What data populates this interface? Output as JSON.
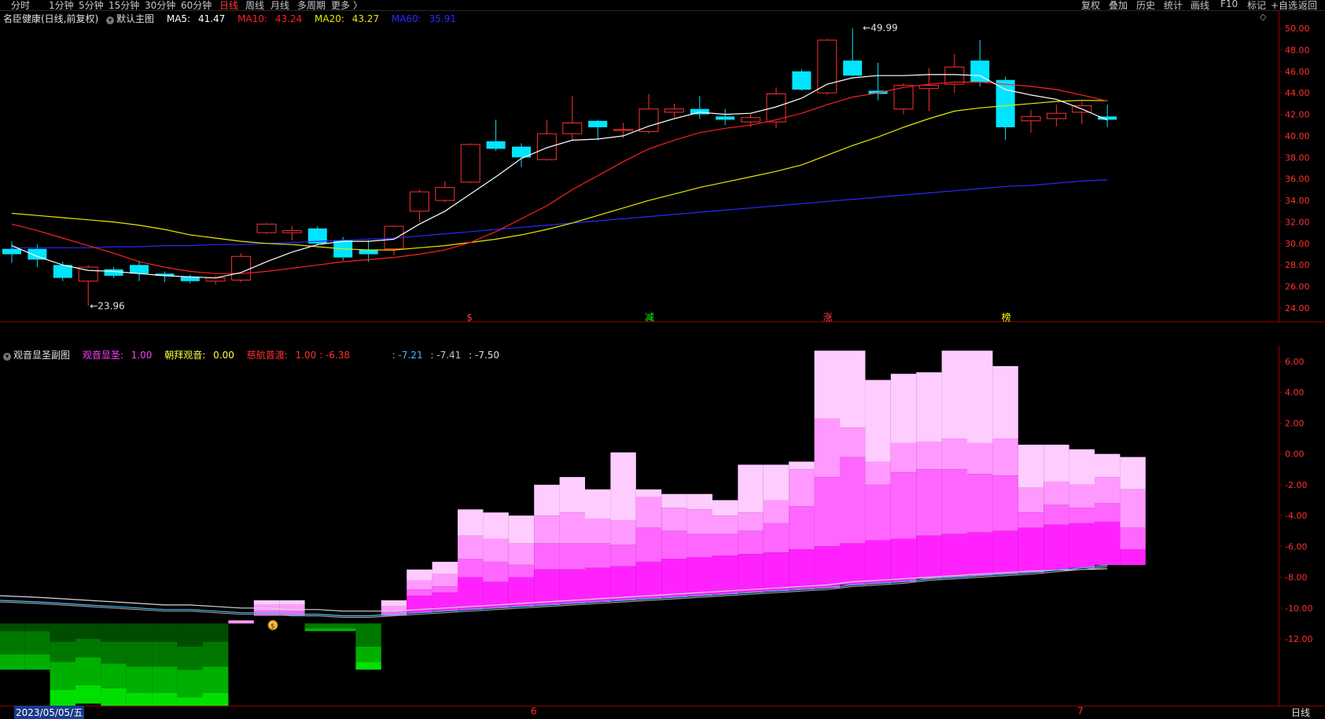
{
  "toolbar": {
    "left_items": [
      "分时",
      "1分钟",
      "5分钟",
      "15分钟",
      "30分钟",
      "60分钟",
      "日线",
      "周线",
      "月线",
      "多周期",
      "更多 〉"
    ],
    "active_item": "日线",
    "right_items": [
      "复权",
      "叠加",
      "历史",
      "统计",
      "画线",
      "F10",
      "标记",
      "+自选",
      "返回"
    ]
  },
  "main_chart": {
    "title": "名臣健康(日线,前复权)",
    "indicator_name": "默认主图",
    "ma5": {
      "label": "MA5:",
      "value": "41.47",
      "color": "#ffffff"
    },
    "ma10": {
      "label": "MA10:",
      "value": "43.24",
      "color": "#ff2020"
    },
    "ma20": {
      "label": "MA20:",
      "value": "43.27",
      "color": "#e8e800"
    },
    "ma60": {
      "label": "MA60:",
      "value": "35.91",
      "color": "#2a2aff"
    },
    "high_label": "49.99",
    "low_label": "23.96",
    "y_ticks": [
      "50.00",
      "48.00",
      "46.00",
      "44.00",
      "42.00",
      "40.00",
      "38.00",
      "36.00",
      "34.00",
      "32.00",
      "30.00",
      "28.00",
      "26.00",
      "24.00"
    ],
    "event_marks": [
      {
        "text": "$",
        "color": "#ff3b3b"
      },
      {
        "text": "减",
        "color": "#00ff00"
      },
      {
        "text": "涨",
        "color": "#ff3b3b"
      },
      {
        "text": "榜",
        "color": "#ffff00"
      }
    ],
    "colors": {
      "up": "#ff3030",
      "down": "#00e5ff",
      "ma5": "#ffffff",
      "ma10": "#ff2020",
      "ma20": "#e8e800",
      "ma60": "#2a2aff"
    }
  },
  "sub_chart": {
    "title": "观音显圣副图",
    "item1": {
      "label": "观音显圣:",
      "value": "1.00",
      "color": "#ff40ff"
    },
    "item2": {
      "label": "朝拜观音:",
      "value": "0.00",
      "color": "#ffff40"
    },
    "item3": {
      "label": "慈航普渡:",
      "value": "1.00 : -6.38",
      "color": "#ff3030"
    },
    "item4": {
      "value": ": -7.21",
      "color": "#40c0ff"
    },
    "item5": {
      "value": ": -7.41",
      "color": "#c0c0c0"
    },
    "item6": {
      "value": ": -7.50",
      "color": "#e0e0e0"
    },
    "y_ticks": [
      "6.00",
      "4.00",
      "2.00",
      "0.00",
      "-2.00",
      "-4.00",
      "-6.00",
      "-8.00",
      "-10.00",
      "-12.00"
    ],
    "money_icon": "money-bag-icon"
  },
  "bottom": {
    "date_label": "2023/05/05/五",
    "month_marks": [
      "6",
      "7"
    ],
    "period_label": "日线"
  },
  "chart_data": {
    "type": "candlestick",
    "ohlc": [
      [
        29.5,
        30.2,
        28.2,
        29.0
      ],
      [
        29.5,
        29.9,
        27.8,
        28.5
      ],
      [
        28.0,
        28.3,
        26.5,
        26.8
      ],
      [
        26.5,
        28.0,
        24.2,
        27.8
      ],
      [
        27.6,
        27.8,
        26.8,
        27.0
      ],
      [
        28.0,
        28.4,
        26.5,
        27.2
      ],
      [
        27.2,
        27.4,
        26.4,
        27.0
      ],
      [
        26.9,
        27.1,
        26.3,
        26.5
      ],
      [
        26.5,
        27.0,
        26.2,
        26.8
      ],
      [
        26.6,
        29.1,
        26.4,
        28.8
      ],
      [
        31.0,
        31.9,
        30.9,
        31.8
      ],
      [
        31.0,
        31.6,
        30.3,
        31.2
      ],
      [
        31.4,
        31.6,
        29.8,
        30.0
      ],
      [
        30.3,
        30.6,
        28.4,
        28.7
      ],
      [
        29.4,
        30.3,
        28.3,
        29.0
      ],
      [
        29.5,
        31.7,
        28.9,
        31.6
      ],
      [
        33.0,
        35.0,
        32.0,
        34.8
      ],
      [
        34.0,
        35.8,
        33.8,
        35.2
      ],
      [
        35.7,
        39.3,
        35.6,
        39.2
      ],
      [
        39.5,
        41.5,
        38.6,
        38.8
      ],
      [
        39.0,
        39.3,
        37.1,
        38.0
      ],
      [
        37.8,
        41.5,
        37.7,
        40.2
      ],
      [
        40.2,
        43.7,
        39.6,
        41.2
      ],
      [
        41.4,
        41.5,
        39.6,
        40.8
      ],
      [
        40.5,
        41.2,
        39.8,
        40.6
      ],
      [
        40.4,
        43.9,
        40.2,
        42.5
      ],
      [
        42.2,
        43.0,
        41.7,
        42.5
      ],
      [
        42.5,
        43.7,
        41.6,
        42.0
      ],
      [
        41.8,
        42.5,
        41.0,
        41.5
      ],
      [
        41.3,
        42.0,
        40.8,
        41.7
      ],
      [
        41.3,
        44.5,
        40.7,
        43.9
      ],
      [
        46.0,
        46.2,
        44.2,
        44.3
      ],
      [
        44.0,
        49.0,
        43.8,
        48.9
      ],
      [
        47.0,
        50.0,
        45.8,
        45.6
      ],
      [
        44.2,
        46.8,
        43.3,
        43.9
      ],
      [
        42.5,
        44.9,
        42.0,
        44.7
      ],
      [
        44.4,
        46.3,
        42.3,
        44.7
      ],
      [
        44.8,
        47.6,
        44.0,
        46.4
      ],
      [
        47.0,
        48.9,
        44.6,
        45.0
      ],
      [
        45.2,
        45.5,
        39.6,
        40.8
      ],
      [
        41.4,
        42.4,
        40.3,
        41.8
      ],
      [
        41.6,
        42.9,
        40.9,
        42.1
      ],
      [
        42.2,
        43.2,
        41.1,
        42.8
      ],
      [
        41.8,
        42.9,
        40.8,
        41.5
      ]
    ],
    "ma5": [
      29.8,
      28.8,
      28.0,
      27.5,
      27.4,
      27.2,
      27.0,
      26.9,
      26.8,
      27.3,
      28.3,
      29.2,
      29.9,
      30.2,
      30.2,
      30.4,
      31.8,
      33.0,
      34.6,
      36.2,
      37.9,
      38.9,
      39.6,
      39.7,
      40.0,
      40.9,
      41.6,
      42.2,
      42.0,
      42.1,
      42.7,
      43.5,
      44.8,
      45.4,
      45.6,
      45.6,
      45.7,
      45.7,
      45.6,
      44.3,
      43.8,
      43.4,
      42.5,
      41.47
    ],
    "ma10": [
      31.8,
      31.2,
      30.5,
      29.8,
      29.1,
      28.3,
      27.8,
      27.4,
      27.2,
      27.2,
      27.4,
      27.7,
      28.0,
      28.3,
      28.5,
      28.7,
      29.0,
      29.4,
      30.1,
      31.1,
      32.3,
      33.5,
      35.0,
      36.3,
      37.6,
      38.8,
      39.6,
      40.3,
      40.7,
      41.0,
      41.5,
      42.1,
      42.9,
      43.6,
      44.0,
      44.5,
      44.8,
      45.0,
      45.0,
      44.8,
      44.6,
      44.3,
      43.8,
      43.24
    ],
    "ma20": [
      32.8,
      32.6,
      32.4,
      32.2,
      32.0,
      31.7,
      31.3,
      30.8,
      30.5,
      30.2,
      30.0,
      29.9,
      29.7,
      29.5,
      29.4,
      29.4,
      29.6,
      29.8,
      30.1,
      30.4,
      30.8,
      31.3,
      31.9,
      32.6,
      33.3,
      34.0,
      34.6,
      35.2,
      35.7,
      36.2,
      36.7,
      37.3,
      38.2,
      39.1,
      39.9,
      40.8,
      41.6,
      42.3,
      42.6,
      42.8,
      43.0,
      43.2,
      43.3,
      43.27
    ],
    "ma60": [
      29.6,
      29.6,
      29.6,
      29.6,
      29.7,
      29.7,
      29.8,
      29.8,
      29.9,
      29.9,
      30.0,
      30.1,
      30.2,
      30.3,
      30.4,
      30.5,
      30.7,
      30.9,
      31.1,
      31.3,
      31.5,
      31.7,
      31.9,
      32.1,
      32.3,
      32.5,
      32.7,
      32.9,
      33.1,
      33.3,
      33.5,
      33.7,
      33.9,
      34.1,
      34.3,
      34.5,
      34.7,
      34.9,
      35.1,
      35.3,
      35.4,
      35.6,
      35.8,
      35.91
    ],
    "sub_levels": [
      [
        -11.5,
        -13.0,
        -14.0,
        -14.0
      ],
      [
        -11.5,
        -13.0,
        -14.0,
        -14.0
      ],
      [
        -12.2,
        -13.5,
        -15.3,
        -16.5
      ],
      [
        -12.0,
        -13.2,
        -15.0,
        -16.2
      ],
      [
        -12.2,
        -13.6,
        -15.2,
        -16.6
      ],
      [
        -12.2,
        -13.8,
        -15.5,
        -16.8
      ],
      [
        -12.2,
        -13.8,
        -15.5,
        -17.0
      ],
      [
        -12.5,
        -14.0,
        -15.8,
        -17.4
      ],
      [
        -12.2,
        -13.8,
        -15.5,
        -17.0
      ],
      [
        -10.8,
        -10.8,
        -11.0,
        -11.0
      ],
      [
        -9.5,
        -9.8,
        -10.2,
        -10.5
      ],
      [
        -9.5,
        -9.8,
        -10.2,
        -10.5
      ],
      [
        -11.0,
        -11.3,
        -11.5,
        -11.5
      ],
      [
        -11.0,
        -11.3,
        -11.5,
        -11.5
      ],
      [
        -11.0,
        -12.5,
        -13.5,
        -14.0
      ],
      [
        -9.5,
        -9.9,
        -10.2,
        -10.5
      ],
      [
        -7.5,
        -8.2,
        -8.8,
        -9.2
      ],
      [
        -7.0,
        -7.8,
        -8.6,
        -9.0
      ],
      [
        -3.6,
        -5.3,
        -6.8,
        -8.0
      ],
      [
        -3.8,
        -5.5,
        -7.0,
        -8.3
      ],
      [
        -4.0,
        -5.8,
        -7.2,
        -8.0
      ],
      [
        -2.0,
        -4.0,
        -5.8,
        -7.5
      ],
      [
        -1.5,
        -3.8,
        -5.8,
        -7.5
      ],
      [
        -2.3,
        -4.2,
        -5.8,
        -7.4
      ],
      [
        0.1,
        -4.3,
        -5.9,
        -7.3
      ],
      [
        -2.3,
        -2.8,
        -4.8,
        -7.0
      ],
      [
        -2.6,
        -3.5,
        -5.0,
        -6.8
      ],
      [
        -2.6,
        -3.6,
        -5.2,
        -6.7
      ],
      [
        -3.0,
        -4.0,
        -5.2,
        -6.6
      ],
      [
        -0.7,
        -3.8,
        -5.0,
        -6.5
      ],
      [
        -0.7,
        -3.0,
        -4.5,
        -6.4
      ],
      [
        -0.5,
        -1.0,
        -3.4,
        -6.2
      ],
      [
        6.7,
        2.3,
        -1.5,
        -6.0
      ],
      [
        6.7,
        1.7,
        -0.2,
        -5.8
      ],
      [
        4.8,
        -0.5,
        -2.0,
        -5.6
      ],
      [
        5.2,
        0.7,
        -1.2,
        -5.5
      ],
      [
        5.3,
        0.8,
        -1.0,
        -5.3
      ],
      [
        6.7,
        1.0,
        -1.0,
        -5.2
      ],
      [
        6.7,
        0.7,
        -1.3,
        -5.1
      ],
      [
        5.7,
        1.0,
        -1.4,
        -5.0
      ],
      [
        0.6,
        -2.2,
        -3.8,
        -4.8
      ],
      [
        0.6,
        -1.8,
        -3.3,
        -4.6
      ],
      [
        0.3,
        -2.0,
        -3.5,
        -4.5
      ],
      [
        0.0,
        -1.5,
        -3.2,
        -4.4
      ],
      [
        -0.2,
        -2.3,
        -4.8,
        -6.2
      ]
    ],
    "sub_lines": {
      "white": [
        -9.2,
        -9.3,
        -9.4,
        -9.5,
        -9.6,
        -9.7,
        -9.8,
        -9.8,
        -9.9,
        -10.0,
        -10.0,
        -10.1,
        -10.1,
        -10.2,
        -10.2,
        -10.2,
        -10.1,
        -10.0,
        -9.9,
        -9.8,
        -9.7,
        -9.6,
        -9.5,
        -9.4,
        -9.3,
        -9.2,
        -9.1,
        -9.0,
        -8.9,
        -8.8,
        -8.7,
        -8.6,
        -8.5,
        -8.3,
        -8.2,
        -8.1,
        -8.0,
        -7.9,
        -7.8,
        -7.7,
        -7.6,
        -7.55,
        -7.5,
        -7.45
      ],
      "cyan": [
        -9.5,
        -9.6,
        -9.7,
        -9.8,
        -9.9,
        -10.0,
        -10.1,
        -10.1,
        -10.2,
        -10.3,
        -10.3,
        -10.4,
        -10.4,
        -10.5,
        -10.5,
        -10.4,
        -10.3,
        -10.2,
        -10.1,
        -10.0,
        -9.9,
        -9.8,
        -9.7,
        -9.6,
        -9.5,
        -9.4,
        -9.3,
        -9.2,
        -9.1,
        -9.0,
        -8.9,
        -8.8,
        -8.7,
        -8.5,
        -8.4,
        -8.3,
        -8.1,
        -8.0,
        -7.9,
        -7.8,
        -7.7,
        -7.55,
        -7.4,
        -7.21
      ]
    }
  }
}
